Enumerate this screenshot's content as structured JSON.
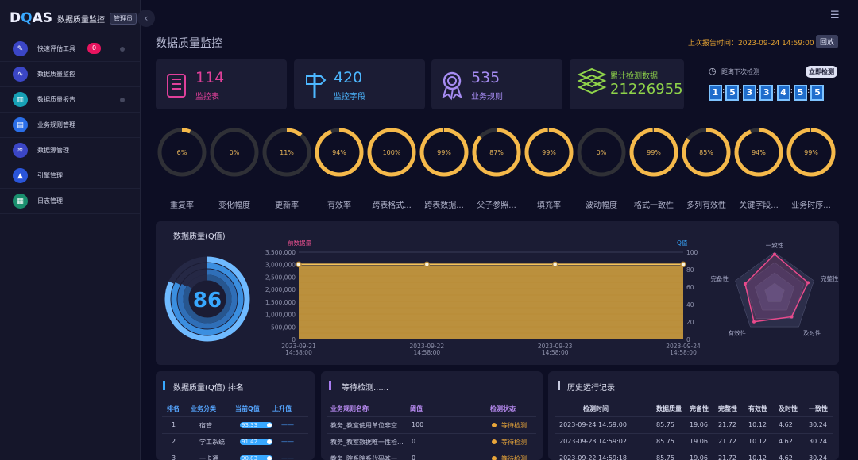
{
  "app": {
    "logo": "DQAS",
    "logo_pre": "D",
    "logo_q": "Q",
    "logo_post": "AS",
    "title": "数据质量监控",
    "role": "管理员"
  },
  "sidebar": {
    "items": [
      {
        "label": "快速评估工具",
        "icon": "pencil-icon",
        "color": "#3b46c6",
        "badge": "0"
      },
      {
        "label": "数据质量监控",
        "icon": "pulse-icon",
        "color": "#3b46c6"
      },
      {
        "label": "数据质量报告",
        "icon": "bar-chart-icon",
        "color": "#17a1b6"
      },
      {
        "label": "业务规则管理",
        "icon": "document-icon",
        "color": "#2a6ee8"
      },
      {
        "label": "数据源管理",
        "icon": "database-icon",
        "color": "#3b46c6"
      },
      {
        "label": "引擎管理",
        "icon": "rocket-icon",
        "color": "#2a55d9"
      },
      {
        "label": "日志管理",
        "icon": "calendar-icon",
        "color": "#1a8f6e"
      }
    ]
  },
  "header": {
    "page_title": "数据质量监控",
    "report_time": "上次报告时间：2023-09-24 14:59:00",
    "rollback": "回放"
  },
  "cards": [
    {
      "value": "114",
      "label": "监控表",
      "color": "#e0409a",
      "icon": "report-icon"
    },
    {
      "value": "420",
      "label": "监控字段",
      "color": "#4db7ff",
      "icon": "signpost-icon"
    },
    {
      "value": "535",
      "label": "业务规则",
      "color": "#a68cf2",
      "icon": "medal-icon"
    },
    {
      "value": "212269552...",
      "label": "累计检测数据",
      "color": "#8fd34a",
      "icon": "layers-icon"
    }
  ],
  "countdown": {
    "label": "距离下次检测",
    "button": "立即检测",
    "digits": [
      "1",
      "5",
      "3",
      "3",
      "4",
      "5",
      "5"
    ]
  },
  "gauges": [
    {
      "label": "重复率",
      "percent": 6,
      "text": "6%"
    },
    {
      "label": "变化幅度",
      "percent": 0,
      "text": "0%"
    },
    {
      "label": "更新率",
      "percent": 11,
      "text": "11%"
    },
    {
      "label": "有效率",
      "percent": 94,
      "text": "94%"
    },
    {
      "label": "跨表格式...",
      "percent": 100,
      "text": "100%"
    },
    {
      "label": "跨表数据...",
      "percent": 99,
      "text": "99%"
    },
    {
      "label": "父子参照...",
      "percent": 87,
      "text": "87%"
    },
    {
      "label": "填充率",
      "percent": 99,
      "text": "99%"
    },
    {
      "label": "波动幅度",
      "percent": 0,
      "text": "0%"
    },
    {
      "label": "格式一致性",
      "percent": 99,
      "text": "99%"
    },
    {
      "label": "多列有效性",
      "percent": 85,
      "text": "85%"
    },
    {
      "label": "关键字段...",
      "percent": 94,
      "text": "94%"
    },
    {
      "label": "业务时序...",
      "percent": 99,
      "text": "99%"
    }
  ],
  "quality_panel": {
    "title": "数据质量(Q值)",
    "score": "86",
    "score_value": 86
  },
  "chart_data": {
    "type": "area",
    "x": [
      "2023-09-21 14:58:00",
      "2023-09-22 14:58:00",
      "2023-09-23 14:58:00",
      "2023-09-24 14:58:00"
    ],
    "series": [
      {
        "name": "前数据量",
        "values": [
          2950000,
          2950000,
          2950000,
          2950000
        ]
      },
      {
        "name": "Q值",
        "values": [
          86,
          86,
          86,
          86
        ]
      }
    ],
    "y_left_ticks": [
      "0",
      "500,000",
      "1,000,000",
      "1,500,000",
      "2,000,000",
      "2,500,000",
      "3,000,000",
      "3,500,000"
    ],
    "y_right_ticks": [
      "0",
      "20",
      "40",
      "60",
      "80",
      "100"
    ],
    "ylim_left": [
      0,
      3500000
    ],
    "ylim_right": [
      0,
      100
    ],
    "left_label": "前数据量",
    "right_label": "Q值",
    "radar": {
      "axes": [
        "一致性",
        "完整性",
        "及时性",
        "有效性",
        "完备性"
      ],
      "values": [
        95,
        85,
        70,
        85,
        75
      ]
    }
  },
  "ranking": {
    "title": "数据质量(Q值) 排名",
    "headers": [
      "排名",
      "业务分类",
      "当前Q值",
      "上升值"
    ],
    "rows": [
      {
        "rank": "1",
        "category": "宿管",
        "q": "93.33",
        "up": "——",
        "pct": 93
      },
      {
        "rank": "2",
        "category": "学工系统",
        "q": "91.42",
        "up": "——",
        "pct": 91
      },
      {
        "rank": "3",
        "category": "一卡通",
        "q": "90.83",
        "up": "——",
        "pct": 90
      }
    ]
  },
  "waiting": {
    "title": "等待检测......",
    "headers": [
      "业务规则名称",
      "阈值",
      "检测状态"
    ],
    "rows": [
      {
        "name": "教务_教室使用单位非空...",
        "threshold": "100",
        "status": "等待检测"
      },
      {
        "name": "教务_教室数据唯一性检...",
        "threshold": "0",
        "status": "等待检测"
      },
      {
        "name": "教务_院系院系代码唯一...",
        "threshold": "0",
        "status": "等待检测"
      }
    ]
  },
  "history": {
    "title": "历史运行记录",
    "headers": [
      "检测时间",
      "数据质量",
      "完备性",
      "完整性",
      "有效性",
      "及时性",
      "一致性"
    ],
    "rows": [
      [
        "2023-09-24 14:59:00",
        "85.75",
        "19.06",
        "21.72",
        "10.12",
        "4.62",
        "30.24"
      ],
      [
        "2023-09-23 14:59:02",
        "85.75",
        "19.06",
        "21.72",
        "10.12",
        "4.62",
        "30.24"
      ],
      [
        "2023-09-22 14:59:18",
        "85.75",
        "19.06",
        "21.72",
        "10.12",
        "4.62",
        "30.24"
      ]
    ]
  },
  "colors": {
    "accent": "#38a8ff",
    "gauge": "#f5b94a",
    "danger": "#e8145f",
    "chart_fill": "#c99a3e",
    "radar": "#ea4a8c"
  }
}
